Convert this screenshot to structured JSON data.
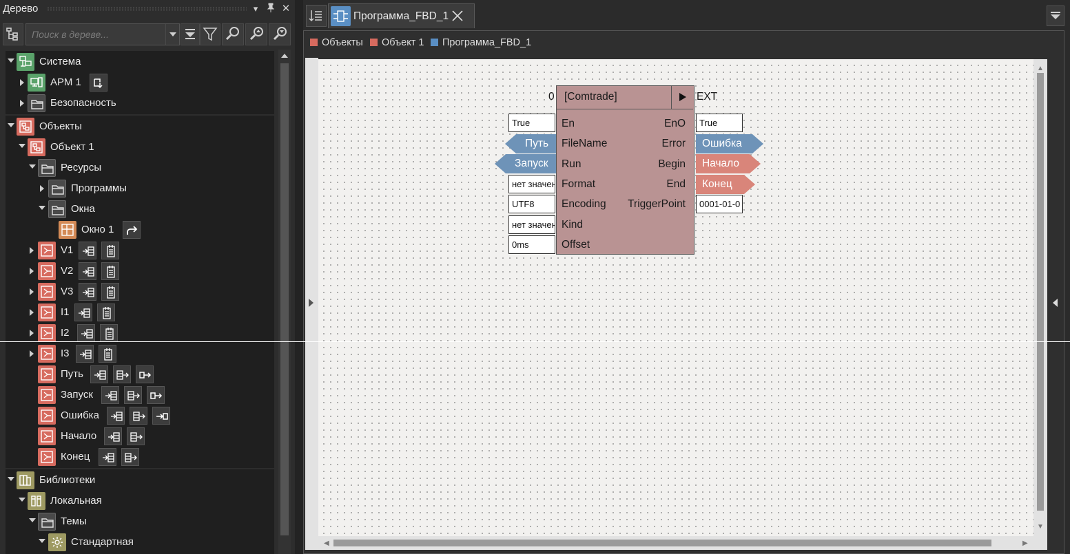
{
  "tree_panel": {
    "title": "Дерево",
    "search_placeholder": "Поиск в дереве...",
    "header_icons": [
      "chevron-down-icon",
      "pin-icon",
      "close-icon"
    ],
    "toolbar_icons": [
      "tree-structure-icon",
      "dropdown-icon",
      "collapse-all-icon",
      "filter-icon",
      "find-icon",
      "find-up-icon",
      "find-down-icon"
    ]
  },
  "tree": {
    "system": {
      "label": "Система",
      "children": [
        {
          "label": "АРМ 1",
          "actions": [
            "goto-icon"
          ]
        },
        {
          "label": "Безопасность"
        }
      ]
    },
    "objects": {
      "label": "Объекты",
      "object1": "Объект 1",
      "resources": "Ресурсы",
      "programs": "Программы",
      "windows": "Окна",
      "window1": "Окно 1",
      "variables": [
        {
          "label": "V1"
        },
        {
          "label": "V2"
        },
        {
          "label": "V3"
        },
        {
          "label": "I1"
        },
        {
          "label": "I2"
        },
        {
          "label": "I3"
        },
        {
          "label": "Путь"
        },
        {
          "label": "Запуск"
        },
        {
          "label": "Ошибка"
        },
        {
          "label": "Начало"
        },
        {
          "label": "Конец"
        }
      ]
    },
    "libraries": {
      "label": "Библиотеки",
      "local": "Локальная",
      "themes": "Темы",
      "standard": "Стандартная"
    }
  },
  "document": {
    "tab_label": "Программа_FBD_1",
    "breadcrumbs": [
      {
        "label": "Объекты",
        "color": "#d76b5f"
      },
      {
        "label": "Объект 1",
        "color": "#d76b5f"
      },
      {
        "label": "Программа_FBD_1",
        "color": "#5a8fc4"
      }
    ]
  },
  "fbd_block": {
    "title": "[Comtrade]",
    "order": "0",
    "ext": "EXT",
    "inputs": [
      "En",
      "FileName",
      "Run",
      "Format",
      "Encoding",
      "Kind",
      "Offset"
    ],
    "outputs": [
      "EnO",
      "Error",
      "Begin",
      "End",
      "TriggerPoint"
    ],
    "input_values": {
      "en": "True",
      "format": "нет значения",
      "encoding": "UTF8",
      "kind": "нет значения",
      "offset": "0ms"
    },
    "input_tags": {
      "filename": "Путь",
      "run": "Запуск"
    },
    "output_values": {
      "eno": "True",
      "triggerpoint": "0001-01-0"
    },
    "output_tags": {
      "error": "Ошибка",
      "begin": "Начало",
      "end": "Конец"
    }
  },
  "colors": {
    "blue_tag": "#6e93b8",
    "red_tag": "#d9857a",
    "block": "#b99393"
  }
}
